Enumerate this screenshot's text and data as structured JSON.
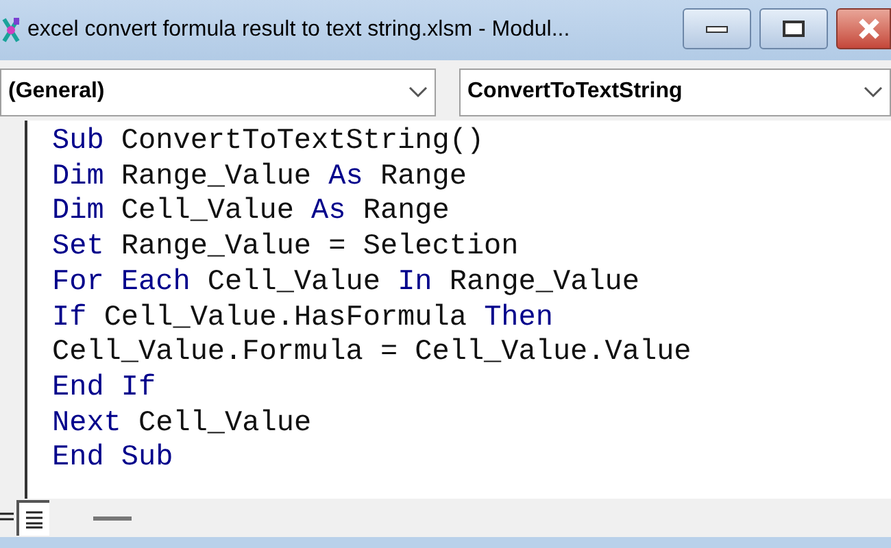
{
  "window": {
    "title": "excel convert formula result to text string.xlsm - Modul..."
  },
  "object_dropdown": {
    "value": "(General)"
  },
  "procedure_dropdown": {
    "value": "ConvertToTextString"
  },
  "code_lines": [
    [
      {
        "text": "Sub",
        "kind": "keyword"
      },
      {
        "text": " ConvertToTextString()",
        "kind": "plain"
      }
    ],
    [
      {
        "text": "Dim",
        "kind": "keyword"
      },
      {
        "text": " Range_Value ",
        "kind": "plain"
      },
      {
        "text": "As",
        "kind": "keyword"
      },
      {
        "text": " Range",
        "kind": "plain"
      }
    ],
    [
      {
        "text": "Dim",
        "kind": "keyword"
      },
      {
        "text": " Cell_Value ",
        "kind": "plain"
      },
      {
        "text": "As",
        "kind": "keyword"
      },
      {
        "text": " Range",
        "kind": "plain"
      }
    ],
    [
      {
        "text": "Set",
        "kind": "keyword"
      },
      {
        "text": " Range_Value = Selection",
        "kind": "plain"
      }
    ],
    [
      {
        "text": "For Each",
        "kind": "keyword"
      },
      {
        "text": " Cell_Value ",
        "kind": "plain"
      },
      {
        "text": "In",
        "kind": "keyword"
      },
      {
        "text": " Range_Value",
        "kind": "plain"
      }
    ],
    [
      {
        "text": "If",
        "kind": "keyword"
      },
      {
        "text": " Cell_Value.HasFormula ",
        "kind": "plain"
      },
      {
        "text": "Then",
        "kind": "keyword"
      }
    ],
    [
      {
        "text": "Cell_Value.Formula = Cell_Value.Value",
        "kind": "plain"
      }
    ],
    [
      {
        "text": "End If",
        "kind": "keyword"
      }
    ],
    [
      {
        "text": "Next",
        "kind": "keyword"
      },
      {
        "text": " Cell_Value",
        "kind": "plain"
      }
    ],
    [
      {
        "text": "End Sub",
        "kind": "keyword"
      }
    ]
  ]
}
